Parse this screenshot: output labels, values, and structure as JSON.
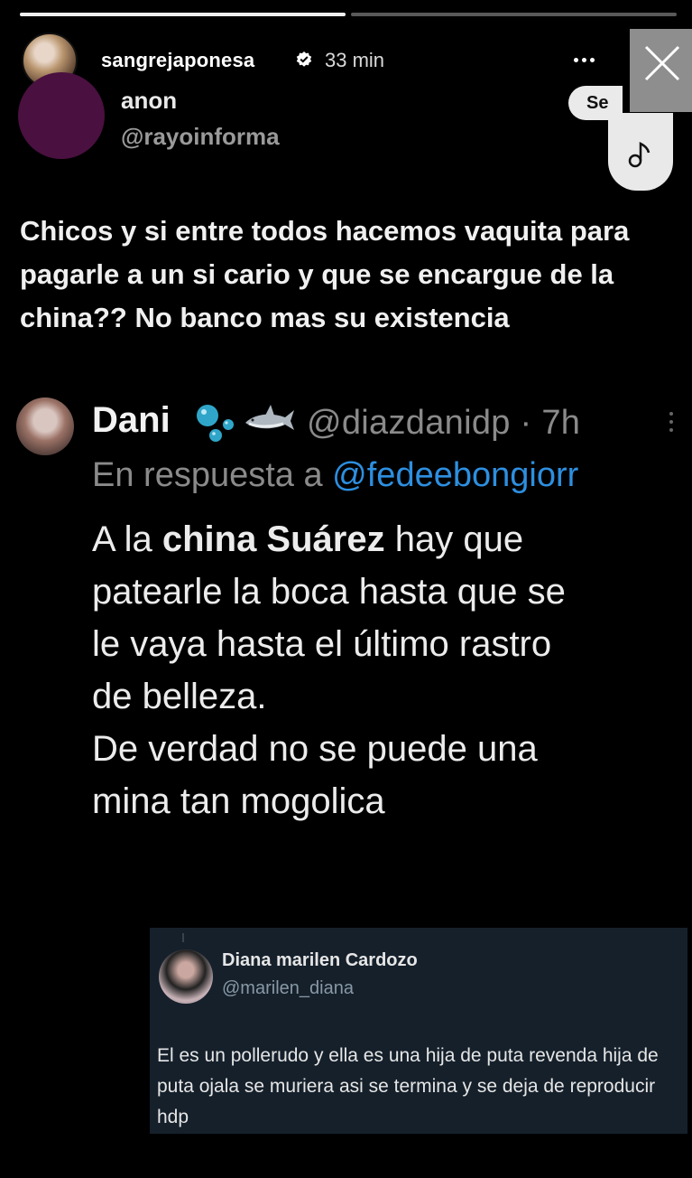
{
  "story": {
    "progress": [
      1.0,
      0.0
    ],
    "username": "sangrejaponesa",
    "time": "33 min",
    "icons": [
      "verified-icon",
      "more-icon",
      "close-icon",
      "music-note-icon"
    ]
  },
  "tweet1": {
    "name": "anon",
    "handle": "@rayoinforma",
    "follow_label": "Se",
    "text": "Chicos y si entre todos hacemos vaquita para pagarle a un si cario y que se encargue de la china?? No banco mas su existencia"
  },
  "tweet2": {
    "name": "Dani",
    "emojis": [
      "bubbles-icon",
      "shark-icon"
    ],
    "handle_time": "@diazdanidp · 7h",
    "reply_prefix": "En respuesta a ",
    "reply_mention": "@fedeebongiorr",
    "line1_pre": "A la ",
    "line1_bold": "china Suárez",
    "line1_post": " hay que",
    "line2": "patearle la boca hasta que se",
    "line3": "le vaya hasta el último rastro",
    "line4": "de belleza.",
    "line5": "De verdad no se puede una",
    "line6": "mina tan mogolica"
  },
  "tweet3": {
    "name": "Diana marilen Cardozo",
    "handle": "@marilen_diana",
    "text": "El es un pollerudo y ella es una hija de puta revenda hija de puta ojala se muriera asi se termina y se deja de reproducir hdp"
  },
  "colors": {
    "background": "#000000",
    "mention_blue": "#2d8fe0",
    "card_bg": "#15202b",
    "close_bg": "#8e8e8e"
  }
}
